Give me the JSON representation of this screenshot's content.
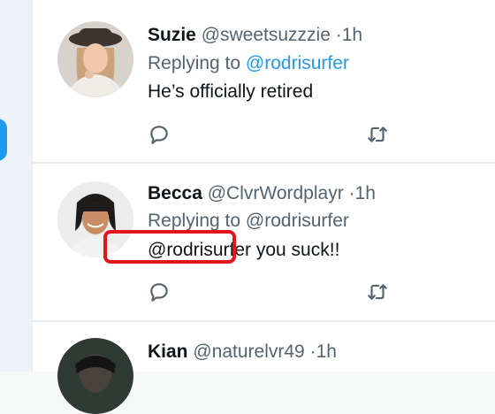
{
  "tweets": [
    {
      "name": "Suzie",
      "handle": "@sweetsuzzzie",
      "separator": "·",
      "time": "1h",
      "replying_prefix": "Replying to",
      "replying_to": "@rodrisurfer",
      "text": "He’s officially retired"
    },
    {
      "name": "Becca",
      "handle": "@ClvrWordplayr",
      "separator": "·",
      "time": "1h",
      "replying_prefix": "Replying to",
      "replying_to": "@rodrisurfer",
      "mention": "@rodrisurfer",
      "text": "you suck!!"
    },
    {
      "name": "Kian",
      "handle": "@naturelvr49",
      "separator": "·",
      "time": "1h"
    }
  ],
  "icons": {
    "reply": "reply-icon",
    "retweet": "retweet-icon"
  },
  "colors": {
    "link": "#1d9bf0",
    "highlight": "#e3151a",
    "secondary_text": "#536471",
    "primary_text": "#0f1419"
  }
}
